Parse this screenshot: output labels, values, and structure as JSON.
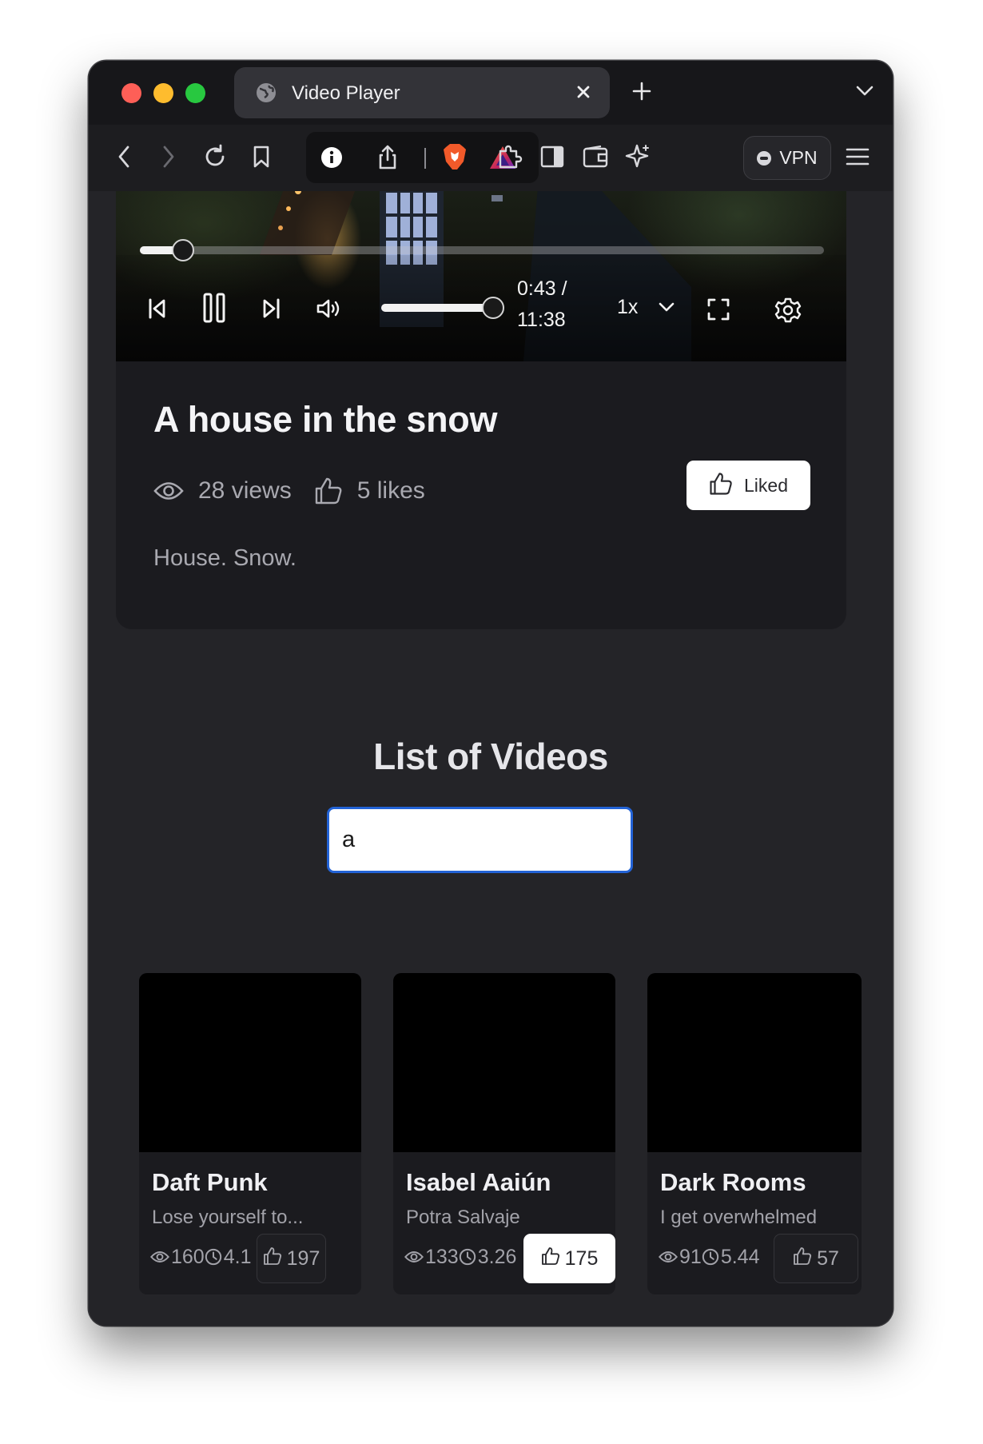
{
  "browser": {
    "tab_title": "Video Player",
    "vpn_label": "VPN"
  },
  "player": {
    "progress_fraction": 0.063,
    "volume_fraction": 1.0,
    "time_current": "0:43 /",
    "time_total": "11:38",
    "speed": "1x"
  },
  "video": {
    "title": "A house in the snow",
    "views": "28 views",
    "likes": "5 likes",
    "liked_label": "Liked",
    "description": "House. Snow."
  },
  "list": {
    "title": "List of Videos",
    "search_value": "a"
  },
  "cards": [
    {
      "title": "Daft Punk",
      "subtitle": "Lose yourself to...",
      "views": "160",
      "duration": "4.1",
      "likes": "197",
      "liked": false
    },
    {
      "title": "Isabel Aaiún",
      "subtitle": "Potra Salvaje",
      "views": "133",
      "duration": "3.26",
      "likes": "175",
      "liked": true
    },
    {
      "title": "Dark Rooms",
      "subtitle": "I get overwhelmed",
      "views": "91",
      "duration": "5.44",
      "likes": "57",
      "liked": false
    }
  ],
  "colors": {
    "accent_blue": "#2363d6",
    "page_bg": "#242428",
    "card_bg": "#1b1b1f"
  }
}
